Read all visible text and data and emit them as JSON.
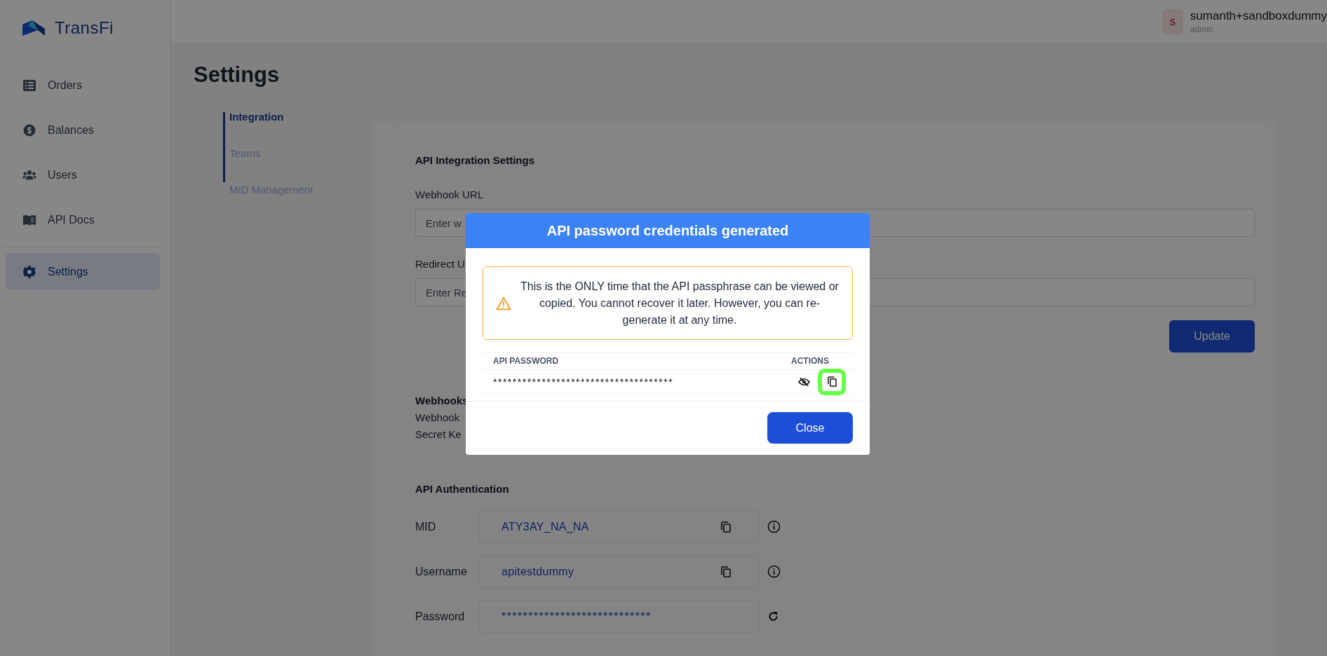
{
  "sidebar": {
    "logo": "TransFi",
    "items": [
      {
        "label": "Orders",
        "selected": false
      },
      {
        "label": "Balances",
        "selected": false
      },
      {
        "label": "Users",
        "selected": false
      },
      {
        "label": "API Docs",
        "selected": false
      },
      {
        "label": "Settings",
        "selected": true
      }
    ]
  },
  "header": {
    "avatar": "s",
    "user": "sumanth+sandboxdummy",
    "role": "admin"
  },
  "page": {
    "title": "Settings",
    "tabs": [
      {
        "label": "Integration",
        "selected": true
      },
      {
        "label": "Teams",
        "selected": false
      },
      {
        "label": "MID Management",
        "selected": false
      }
    ]
  },
  "integration": {
    "title": "API Integration Settings",
    "fields": [
      {
        "label": "Webhook URL",
        "placeholder": "Enter w"
      },
      {
        "label": "Redirect U",
        "placeholder": "Enter Re"
      }
    ],
    "button": "Update"
  },
  "webhooks": {
    "title": "Webhooks",
    "lines": [
      "Webhook",
      "Secret Ke"
    ]
  },
  "auth": {
    "title": "API Authentication",
    "rows": [
      {
        "label": "MID",
        "value": "ATY3AY_NA_NA",
        "kind": "copy"
      },
      {
        "label": "Username",
        "value": "apitestdummy",
        "kind": "copy"
      },
      {
        "label": "Password",
        "value": "****************************",
        "kind": "reset"
      }
    ]
  },
  "modal": {
    "title": "API password credentials generated",
    "warning": "This is the ONLY time that the API passphrase can be viewed or copied. You cannot recover it later. However, you can re-generate it at any time.",
    "columns": [
      "API PASSWORD",
      "ACTIONS"
    ],
    "password": "*************************************",
    "actions": [
      {
        "kind": "hide",
        "highlighted": false
      },
      {
        "kind": "copy",
        "highlighted": true
      }
    ],
    "button": "Close"
  }
}
